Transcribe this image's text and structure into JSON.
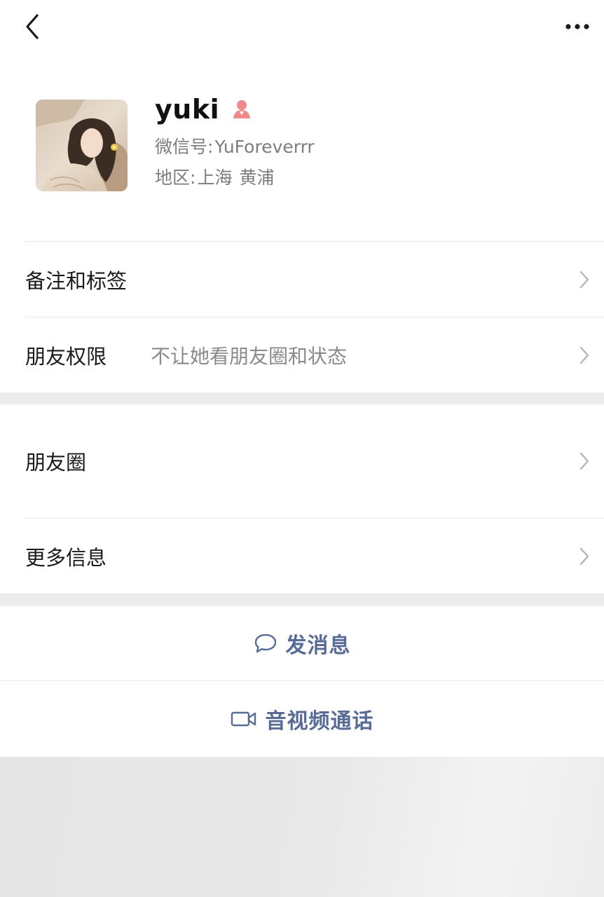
{
  "topbar": {
    "back_icon": "chevron-left-icon",
    "more_icon": "ellipsis-icon"
  },
  "profile": {
    "name": "yuki",
    "gender_icon": "female-person-icon",
    "gender_icon_color": "#f08a8a",
    "wechat_id_label": "微信号:",
    "wechat_id": "YuForeverrr",
    "region_label": "地区:",
    "region_city": "上海",
    "region_district": "黄浦"
  },
  "list": {
    "remarks_tags": "备注和标签",
    "friend_permissions": "朋友权限",
    "friend_permissions_value": "不让她看朋友圈和状态",
    "moments": "朋友圈",
    "more_info": "更多信息"
  },
  "actions": {
    "send_message": "发消息",
    "send_message_icon": "chat-bubble-icon",
    "av_call": "音视频通话",
    "av_call_icon": "video-camera-icon",
    "link_color": "#576b95"
  }
}
